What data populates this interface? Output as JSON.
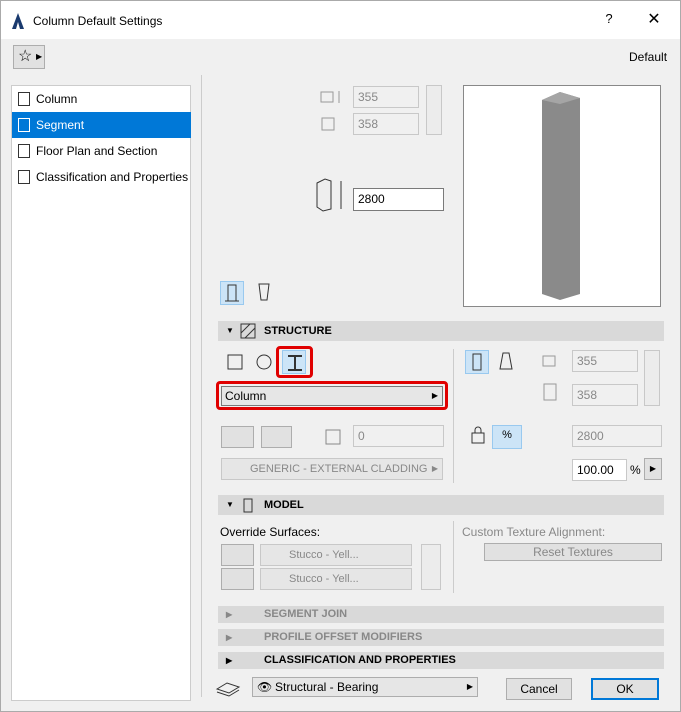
{
  "window": {
    "title": "Column Default Settings",
    "help": "?",
    "close": "✕",
    "default_label": "Default"
  },
  "sidebar": {
    "items": [
      {
        "label": "Column"
      },
      {
        "label": "Segment"
      },
      {
        "label": "Floor Plan and Section"
      },
      {
        "label": "Classification and Properties"
      }
    ]
  },
  "top": {
    "width1": "355",
    "width2": "358",
    "height": "2800"
  },
  "structure": {
    "header": "STRUCTURE",
    "profile_select": "Column",
    "offset_value": "0",
    "material": "GENERIC - EXTERNAL CLADDING",
    "right_width1": "355",
    "right_width2": "358",
    "right_height": "2800",
    "percent_value": "100.00",
    "percent_unit": "%",
    "percent_btn": "%"
  },
  "model": {
    "header": "MODEL",
    "override_label": "Override Surfaces:",
    "surface1": "Stucco - Yell...",
    "surface2": "Stucco - Yell...",
    "texture_label": "Custom Texture Alignment:",
    "reset_button": "Reset Textures"
  },
  "panels": {
    "segment_join": "SEGMENT JOIN",
    "profile_offset": "PROFILE OFFSET MODIFIERS",
    "classification": "CLASSIFICATION AND PROPERTIES"
  },
  "footer": {
    "layer": "Structural - Bearing",
    "cancel": "Cancel",
    "ok": "OK"
  }
}
